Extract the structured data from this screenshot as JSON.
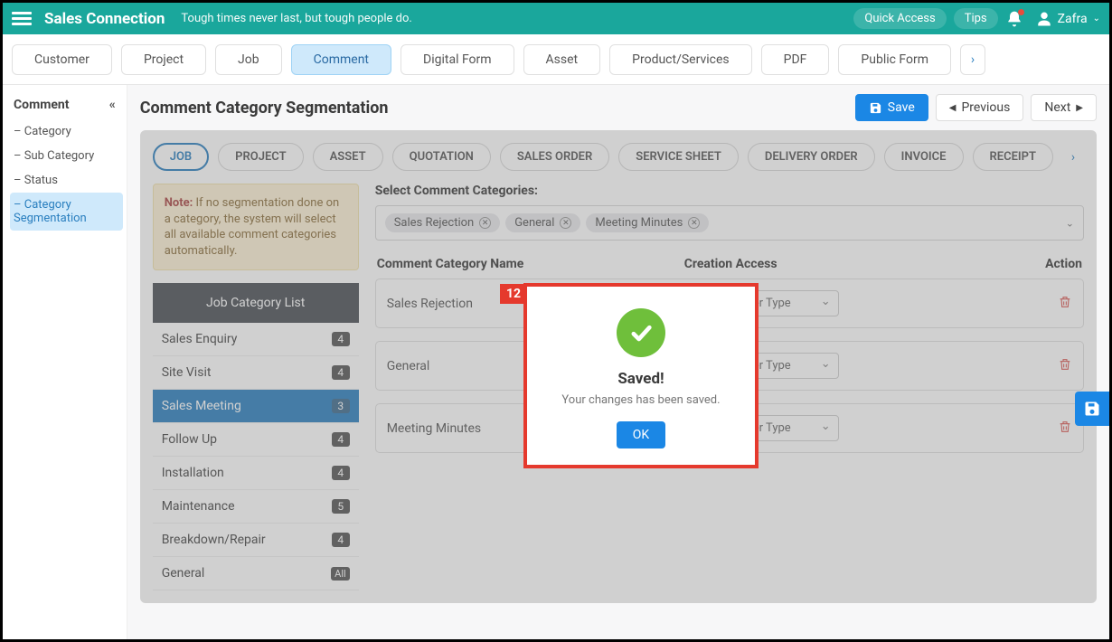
{
  "header": {
    "brand": "Sales Connection",
    "tagline": "Tough times never last, but tough people do.",
    "quick_access": "Quick Access",
    "tips": "Tips",
    "user": "Zafra"
  },
  "tabs": {
    "items": [
      "Customer",
      "Project",
      "Job",
      "Comment",
      "Digital Form",
      "Asset",
      "Product/Services",
      "PDF",
      "Public Form"
    ],
    "active_index": 3
  },
  "sidebar": {
    "title": "Comment",
    "items": [
      {
        "label": "Category"
      },
      {
        "label": "Sub Category"
      },
      {
        "label": "Status"
      },
      {
        "label": "Category Segmentation"
      }
    ],
    "active_index": 3
  },
  "page": {
    "title": "Comment Category Segmentation",
    "save": "Save",
    "previous": "Previous",
    "next": "Next"
  },
  "subtabs": {
    "items": [
      "JOB",
      "PROJECT",
      "ASSET",
      "QUOTATION",
      "SALES ORDER",
      "SERVICE SHEET",
      "DELIVERY ORDER",
      "INVOICE",
      "RECEIPT"
    ],
    "active_index": 0
  },
  "note": {
    "prefix": "Note:",
    "text": " If no segmentation done on a category, the system will select all available comment categories automatically."
  },
  "categoryList": {
    "title": "Job Category List",
    "items": [
      {
        "label": "Sales Enquiry",
        "badge": "4"
      },
      {
        "label": "Site Visit",
        "badge": "4"
      },
      {
        "label": "Sales Meeting",
        "badge": "3"
      },
      {
        "label": "Follow Up",
        "badge": "4"
      },
      {
        "label": "Installation",
        "badge": "4"
      },
      {
        "label": "Maintenance",
        "badge": "5"
      },
      {
        "label": "Breakdown/Repair",
        "badge": "4"
      },
      {
        "label": "General",
        "badge": "All"
      }
    ],
    "active_index": 2
  },
  "selectSection": {
    "label": "Select Comment Categories:",
    "chips": [
      "Sales Rejection",
      "General",
      "Meeting Minutes"
    ]
  },
  "table": {
    "headers": {
      "name": "Comment Category Name",
      "access": "Creation Access",
      "action": "Action"
    },
    "select_placeholder": "Select User Type",
    "rows": [
      {
        "name": "Sales Rejection"
      },
      {
        "name": "General"
      },
      {
        "name": "Meeting Minutes"
      }
    ]
  },
  "modal": {
    "badge": "12",
    "title": "Saved!",
    "message": "Your changes has been saved.",
    "ok": "OK"
  }
}
